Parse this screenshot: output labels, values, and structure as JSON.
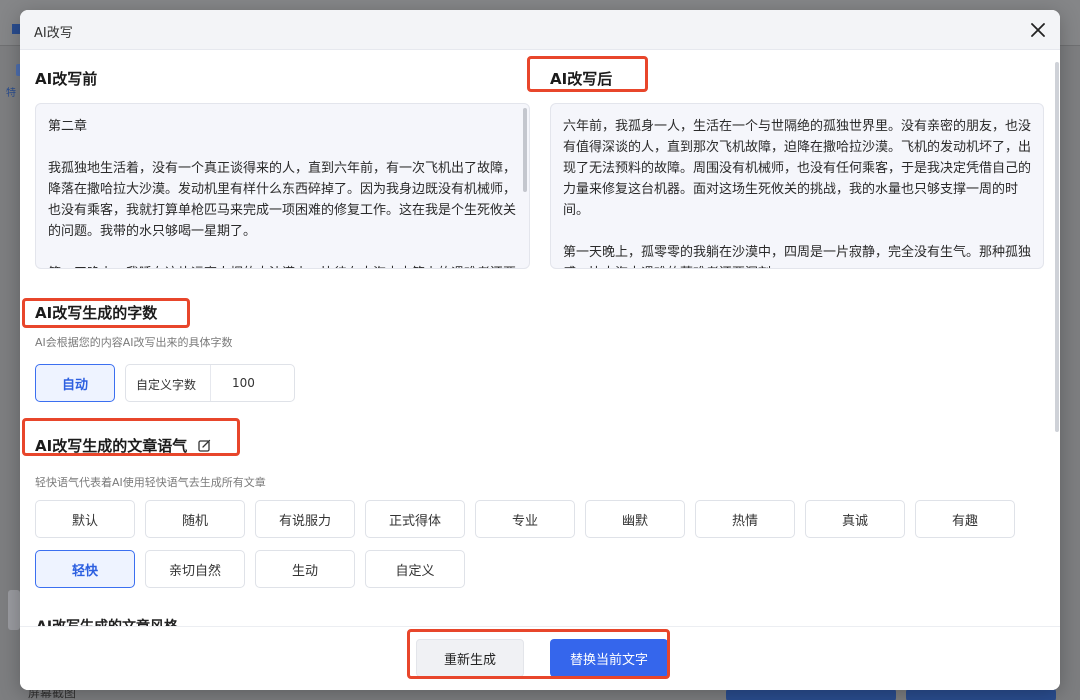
{
  "background": {
    "left_text": "特",
    "footer_text": "屏幕截图"
  },
  "modal": {
    "title": "AI改写"
  },
  "before": {
    "title": "AI改写前",
    "text": "第二章\n\n我孤独地生活着，没有一个真正谈得来的人，直到六年前，有一次飞机出了故障，降落在撒哈拉大沙漠。发动机里有样什么东西碎掉了。因为我身边既没有机械师，也没有乘客，我就打算单枪匹马来完成一项困难的修复工作。这在我是个生死攸关的问题。我带的水只够喝一星期了。\n\n第一天晚上，我睡在这片远离人烟的大沙漠上，比待在大海中木筏上的遇难者还要孤独。"
  },
  "after": {
    "title": "AI改写后",
    "text": "六年前，我孤身一人，生活在一个与世隔绝的孤独世界里。没有亲密的朋友，也没有值得深谈的人，直到那次飞机故障，迫降在撒哈拉沙漠。飞机的发动机坏了，出现了无法预料的故障。周围没有机械师，也没有任何乘客，于是我决定凭借自己的力量来修复这台机器。面对这场生死攸关的挑战，我的水量也只够支撑一周的时间。\n\n第一天晚上，孤零零的我躺在沙漠中，四周是一片寂静，完全没有生气。那种孤独感，比大海中遇难的落难者还要深刻。"
  },
  "word_count": {
    "title": "AI改写生成的字数",
    "description": "AI会根据您的内容AI改写出来的具体字数",
    "auto_label": "自动",
    "custom_label": "自定义字数",
    "custom_value": "100"
  },
  "tone": {
    "title": "AI改写生成的文章语气",
    "description": "轻快语气代表着AI使用轻快语气去生成所有文章",
    "options": [
      "默认",
      "随机",
      "有说服力",
      "正式得体",
      "专业",
      "幽默",
      "热情",
      "真诚",
      "有趣",
      "轻快",
      "亲切自然",
      "生动",
      "自定义"
    ],
    "selected": "轻快"
  },
  "style_title_cut": "AI改写生成的文章风格",
  "footer": {
    "regenerate_label": "重新生成",
    "replace_label": "替换当前文字"
  },
  "colors": {
    "accent": "#3566ec",
    "highlight": "#e8462b"
  }
}
